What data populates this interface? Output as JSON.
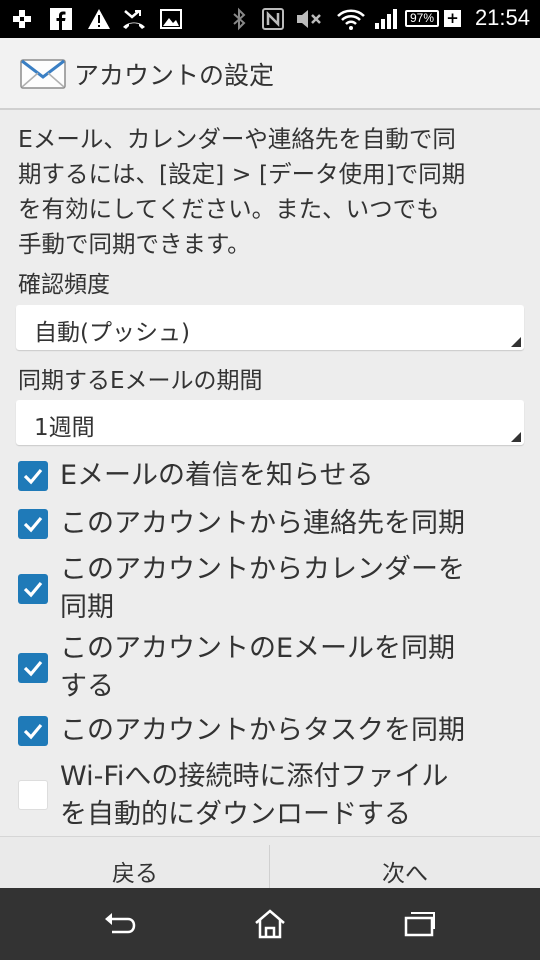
{
  "status_bar": {
    "time": "21:54",
    "battery": "97%",
    "icons": [
      "usb-debug-icon",
      "facebook-icon",
      "warning-icon",
      "missed-call-icon",
      "image-icon",
      "bluetooth-icon",
      "nfc-icon",
      "mute-icon",
      "wifi-icon",
      "signal-icon",
      "battery-icon",
      "charging-plus-icon"
    ]
  },
  "header": {
    "title": "アカウントの設定",
    "icon": "mail-envelope-icon"
  },
  "description": [
    "Eメール、カレンダーや連絡先を自動で同",
    "期するには、[設定] > [データ使用]で同期",
    "を有効にしてください。また、いつでも",
    "手動で同期できます。"
  ],
  "check_frequency": {
    "label": "確認頻度",
    "value": "自動(プッシュ)"
  },
  "sync_period": {
    "label": "同期するEメールの期間",
    "value": "1週間"
  },
  "options": [
    {
      "lines": [
        "Eメールの着信を知らせる"
      ],
      "checked": true
    },
    {
      "lines": [
        "このアカウントから連絡先を同期"
      ],
      "checked": true
    },
    {
      "lines": [
        "このアカウントからカレンダーを",
        "同期"
      ],
      "checked": true
    },
    {
      "lines": [
        "このアカウントのEメールを同期",
        "する"
      ],
      "checked": true
    },
    {
      "lines": [
        "このアカウントからタスクを同期"
      ],
      "checked": true
    },
    {
      "lines": [
        "Wi-Fiへの接続時に添付ファイル",
        "を自動的にダウンロードする"
      ],
      "checked": false
    }
  ],
  "buttons": {
    "back": "戻る",
    "next": "次へ"
  },
  "nav": [
    "back-icon",
    "home-icon",
    "recent-apps-icon"
  ],
  "colors": {
    "accent": "#1f7ab8",
    "status_bar": "#000000",
    "nav_bar": "#333333",
    "background": "#ededed"
  }
}
